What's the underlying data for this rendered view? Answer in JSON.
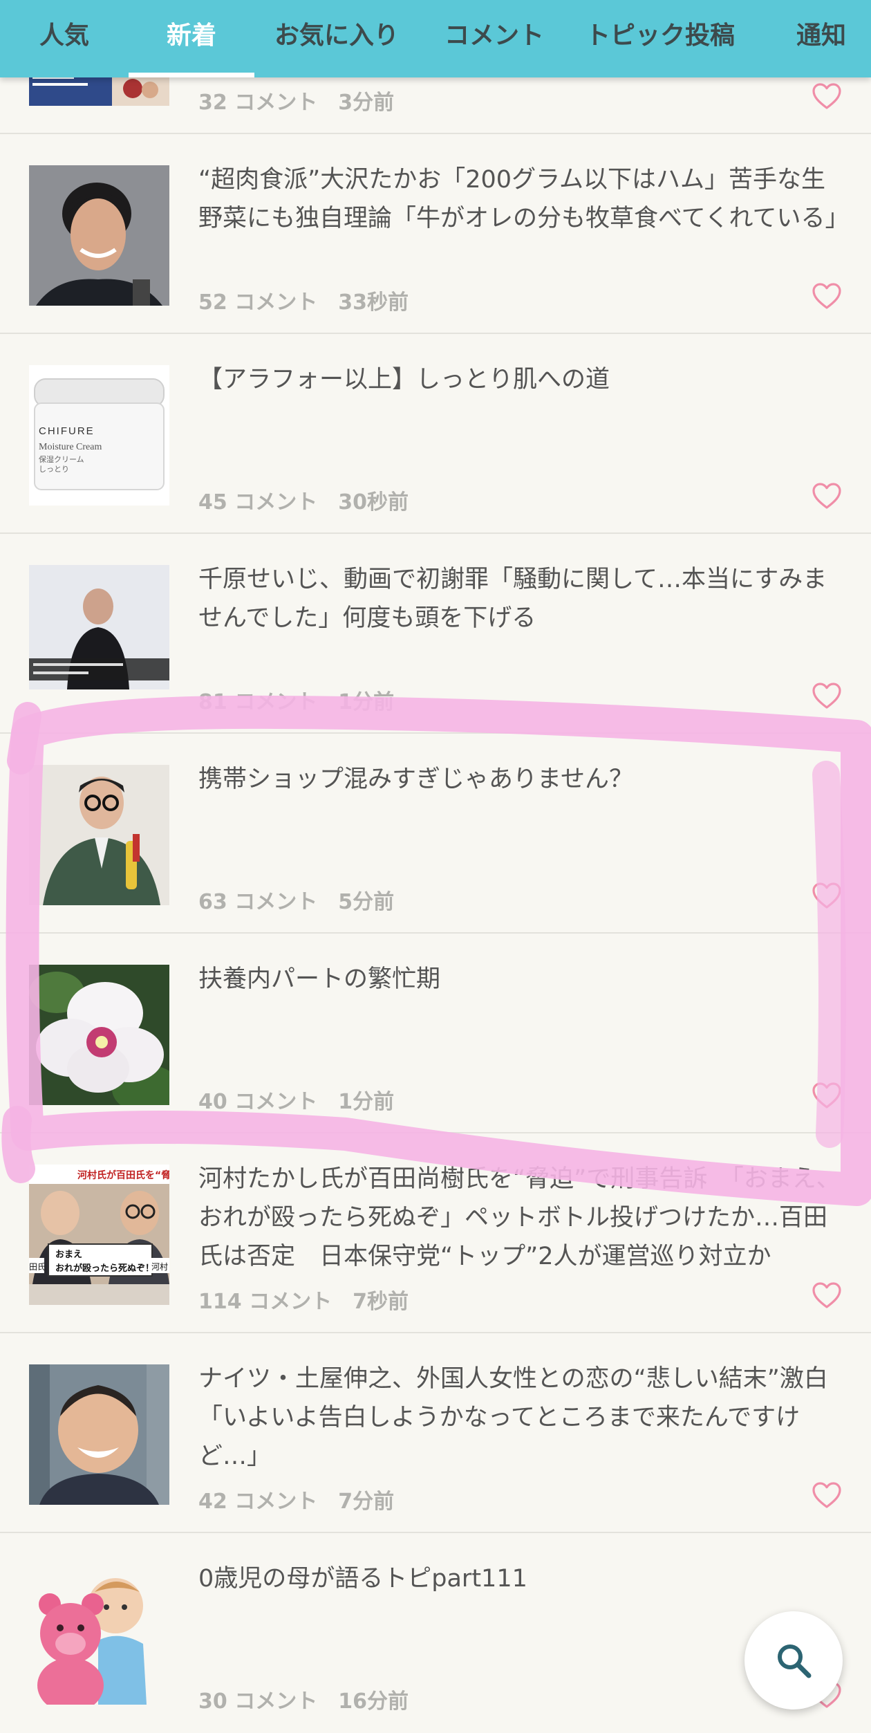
{
  "tabs": [
    {
      "label": "人気",
      "active": false
    },
    {
      "label": "新着",
      "active": true
    },
    {
      "label": "お気に入り",
      "active": false
    },
    {
      "label": "コメント",
      "active": false
    },
    {
      "label": "トピック投稿",
      "active": false
    },
    {
      "label": "通知",
      "active": false
    }
  ],
  "colors": {
    "tabbar": "#5bc8d7",
    "heart": "#f08ea8",
    "annotation": "#f5b4e4",
    "fab_icon": "#2c6472"
  },
  "items": [
    {
      "title": "",
      "comments": "32 コメント",
      "time": "3分前",
      "thumb": "collage"
    },
    {
      "title": "“超肉食派”大沢たかお「200グラム以下はハム」苦手な生野菜にも独自理論「牛がオレの分も牧草食べてくれている」",
      "comments": "52 コメント",
      "time": "33秒前",
      "thumb": "man-portrait"
    },
    {
      "title": "【アラフォー以上】しっとり肌への道",
      "comments": "45 コメント",
      "time": "30秒前",
      "thumb": "cream-jar",
      "thumb_text": {
        "brand": "CHIFURE",
        "line1": "Moisture Cream",
        "line2": "保湿クリーム",
        "line3": "しっとり"
      }
    },
    {
      "title": "千原せいじ、動画で初謝罪「騒動に関して…本当にすみませんでした」何度も頭を下げる",
      "comments": "81 コメント",
      "time": "1分前",
      "thumb": "apology-video"
    },
    {
      "title": "携帯ショップ混みすぎじゃありません？",
      "comments": "63 コメント",
      "time": "5分前",
      "thumb": "man-glasses"
    },
    {
      "title": "扶養内パートの繁忙期",
      "comments": "40 コメント",
      "time": "1分前",
      "thumb": "hibiscus"
    },
    {
      "title": "河村たかし氏が百田尚樹氏を“脅迫”で刑事告訴　「おまえ、おれが殴ったら死ぬぞ」ペットボトル投げつけたか…百田氏は否定　日本保守党“トップ”2人が運営巡り対立か",
      "comments": "114 コメント",
      "time": "7秒前",
      "thumb": "news-caption",
      "thumb_text": {
        "headline": "河村氏が百田氏を“脅迫”",
        "caption1": "おまえ",
        "caption2": "おれが殴ったら死ぬぞ！",
        "left_tag": "田氏",
        "right_tag": "河村"
      }
    },
    {
      "title": "ナイツ・土屋伸之、外国人女性との恋の“悲しい結末”激白「いよいよ告白しようかなってところまで来たんですけど…」",
      "comments": "42 コメント",
      "time": "7分前",
      "thumb": "smiling-man"
    },
    {
      "title": "0歳児の母が語るトピpart111",
      "comments": "30 コメント",
      "time": "16分前",
      "thumb": "baby-bear"
    }
  ]
}
